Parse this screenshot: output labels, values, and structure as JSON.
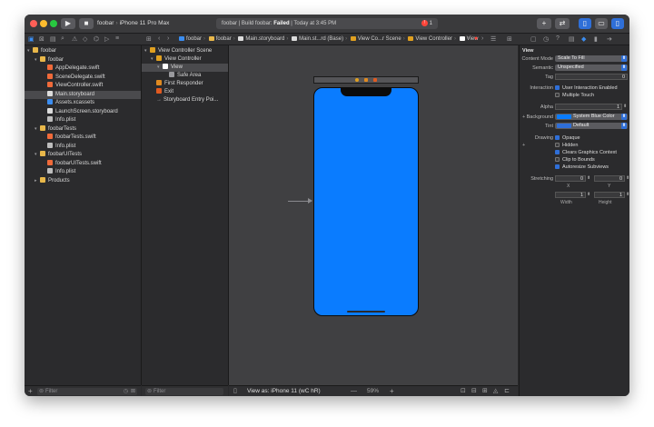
{
  "toolbar": {
    "scheme": {
      "target": "foobar",
      "separator": "›",
      "device": "iPhone 11 Pro Max"
    },
    "status": {
      "prefix": "foobar | Build foobar: ",
      "result": "Failed",
      "suffix": " | Today at 3:45 PM",
      "errors": "1",
      "error_badge": "!"
    },
    "add_label": "+"
  },
  "breadcrumbs": [
    "foobar",
    "foobar",
    "Main.storyboard",
    "Main.st...rd (Base)",
    "View Co...r Scene",
    "View Controller",
    "View"
  ],
  "navigator": {
    "items": [
      {
        "label": "foobar",
        "type": "folder",
        "depth": 0,
        "disclosure": "▾"
      },
      {
        "label": "foobar",
        "type": "folder",
        "depth": 1,
        "disclosure": "▾"
      },
      {
        "label": "AppDelegate.swift",
        "type": "swift",
        "depth": 2,
        "disclosure": ""
      },
      {
        "label": "SceneDelegate.swift",
        "type": "swift",
        "depth": 2,
        "disclosure": ""
      },
      {
        "label": "ViewController.swift",
        "type": "swift",
        "depth": 2,
        "disclosure": ""
      },
      {
        "label": "Main.storyboard",
        "type": "storyboard",
        "depth": 2,
        "disclosure": "",
        "selected": true
      },
      {
        "label": "Assets.xcassets",
        "type": "assets",
        "depth": 2,
        "disclosure": ""
      },
      {
        "label": "LaunchScreen.storyboard",
        "type": "storyboard",
        "depth": 2,
        "disclosure": ""
      },
      {
        "label": "Info.plist",
        "type": "plist",
        "depth": 2,
        "disclosure": ""
      },
      {
        "label": "foobarTests",
        "type": "folder",
        "depth": 1,
        "disclosure": "▾"
      },
      {
        "label": "foobarTests.swift",
        "type": "swift",
        "depth": 2,
        "disclosure": ""
      },
      {
        "label": "Info.plist",
        "type": "plist",
        "depth": 2,
        "disclosure": ""
      },
      {
        "label": "foobarUITests",
        "type": "folder",
        "depth": 1,
        "disclosure": "▾"
      },
      {
        "label": "foobarUITests.swift",
        "type": "swift",
        "depth": 2,
        "disclosure": ""
      },
      {
        "label": "Info.plist",
        "type": "plist",
        "depth": 2,
        "disclosure": ""
      },
      {
        "label": "Products",
        "type": "folder",
        "depth": 1,
        "disclosure": "▸"
      }
    ],
    "filter_placeholder": "Filter"
  },
  "outline": {
    "items": [
      {
        "label": "View Controller Scene",
        "depth": 0,
        "disclosure": "▾",
        "icon_color": "#e0a020"
      },
      {
        "label": "View Controller",
        "depth": 1,
        "disclosure": "▾",
        "icon_color": "#e0a020"
      },
      {
        "label": "View",
        "depth": 2,
        "disclosure": "▾",
        "icon_color": "#ffffff",
        "selected": true
      },
      {
        "label": "Safe Area",
        "depth": 3,
        "disclosure": "",
        "icon_color": "#9a9a9e"
      },
      {
        "label": "First Responder",
        "depth": 1,
        "disclosure": "",
        "icon_color": "#e08a20"
      },
      {
        "label": "Exit",
        "depth": 1,
        "disclosure": "",
        "icon_color": "#e05a20"
      },
      {
        "label": "Storyboard Entry Poi...",
        "depth": 1,
        "disclosure": "",
        "icon_color": "#9a9a9e",
        "arrow": "→"
      }
    ],
    "filter_placeholder": "Filter"
  },
  "canvas": {
    "view_as": "View as: iPhone 11 (wC hR)",
    "zoom": "59%",
    "zoom_out": "—",
    "zoom_in": "+",
    "phone_color": "#0a7cff"
  },
  "inspector": {
    "section": "View",
    "content_mode_label": "Content Mode",
    "content_mode": "Scale To Fill",
    "semantic_label": "Semantic",
    "semantic": "Unspecified",
    "tag_label": "Tag",
    "tag": "0",
    "interaction_label": "Interaction",
    "user_interaction": "User Interaction Enabled",
    "multiple_touch": "Multiple Touch",
    "alpha_label": "Alpha",
    "alpha": "1",
    "background_label": "Background",
    "background": "System Blue Color",
    "tint_label": "Tint",
    "tint": "Default",
    "drawing_label": "Drawing",
    "opaque": "Opaque",
    "hidden": "Hidden",
    "clears": "Clears Graphics Context",
    "clip": "Clip to Bounds",
    "autoresize": "Autoresize Subviews",
    "stretching_label": "Stretching",
    "x_label": "X",
    "y_label": "Y",
    "width_label": "Width",
    "height_label": "Height",
    "stretch_x": "0",
    "stretch_y": "0",
    "stretch_w": "1",
    "stretch_h": "1",
    "plus": "+",
    "background_swatch": "#0a7cff"
  },
  "bottom": {
    "add": "+"
  }
}
